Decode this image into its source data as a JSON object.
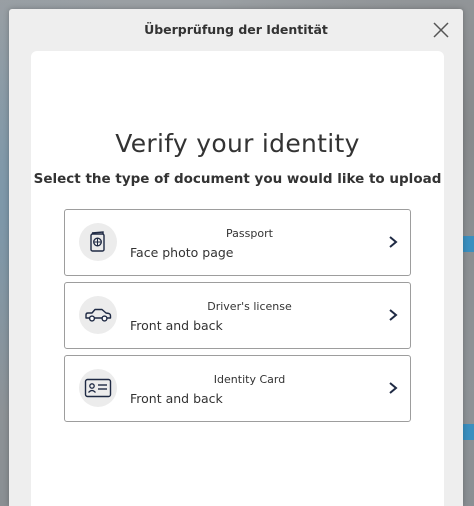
{
  "modal": {
    "title": "Überprüfung der Identität"
  },
  "content": {
    "heading": "Verify your identity",
    "subheading": "Select the type of document you would like to upload"
  },
  "options": [
    {
      "title": "Passport",
      "subtitle": "Face photo page",
      "icon": "passport-icon"
    },
    {
      "title": "Driver's license",
      "subtitle": "Front and back",
      "icon": "car-icon"
    },
    {
      "title": "Identity Card",
      "subtitle": "Front and back",
      "icon": "id-card-icon"
    }
  ],
  "colors": {
    "icon_stroke": "#1f2a44",
    "border": "#9d9d9d"
  }
}
